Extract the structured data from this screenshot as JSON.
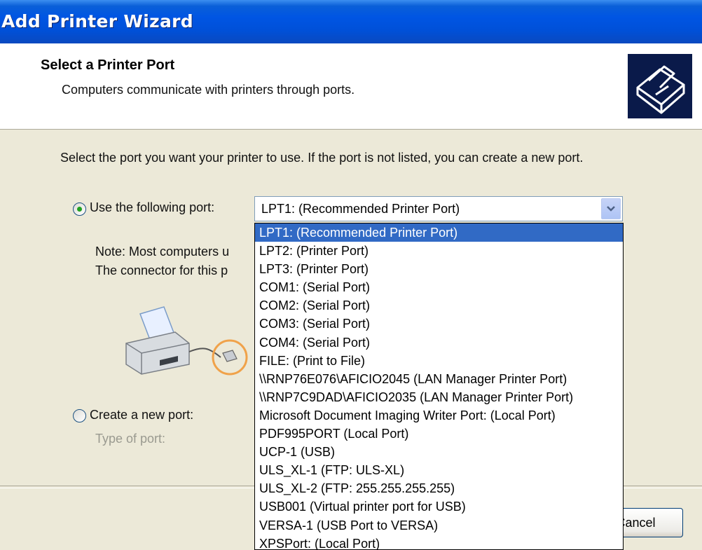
{
  "window": {
    "title": "Add Printer Wizard"
  },
  "header": {
    "title": "Select a Printer Port",
    "subtitle": "Computers communicate with printers through ports."
  },
  "body": {
    "instruction": "Select the port you want your printer to use.  If the port is not listed, you can create a new port.",
    "use_port": {
      "label": "Use the following port:",
      "selected": true,
      "value": "LPT1: (Recommended Printer Port)"
    },
    "note_line1": "Note: Most computers u",
    "note_line2": "The connector for this p",
    "create_port": {
      "label": "Create a new port:",
      "selected": false,
      "type_label": "Type of port:"
    }
  },
  "dropdown": {
    "options": [
      "LPT1: (Recommended Printer Port)",
      "LPT2: (Printer Port)",
      "LPT3: (Printer Port)",
      "COM1: (Serial Port)",
      "COM2: (Serial Port)",
      "COM3: (Serial Port)",
      "COM4: (Serial Port)",
      "FILE: (Print to File)",
      "\\\\RNP76E076\\AFICIO2045 (LAN Manager Printer Port)",
      "\\\\RNP7C9DAD\\AFICIO2035 (LAN Manager Printer Port)",
      "Microsoft Document Imaging Writer Port: (Local Port)",
      "PDF995PORT (Local Port)",
      "UCP-1 (USB)",
      "ULS_XL-1 (FTP: ULS-XL)",
      "ULS_XL-2 (FTP: 255.255.255.255)",
      "USB001 (Virtual printer port for USB)",
      "VERSA-1 (USB Port to VERSA)",
      "XPSPort: (Local Port)"
    ],
    "highlighted_index": 0
  },
  "buttons": {
    "cancel": "Cancel"
  }
}
